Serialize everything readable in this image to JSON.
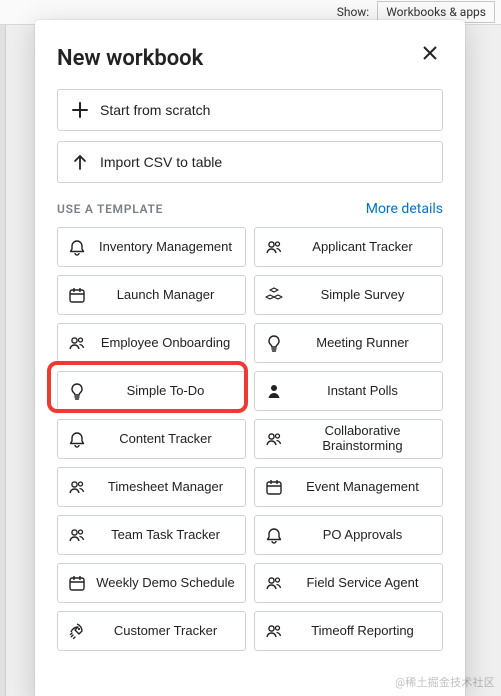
{
  "background": {
    "show_label": "Show:",
    "segment": "Workbooks & apps"
  },
  "modal": {
    "title": "New workbook",
    "close_aria": "Close",
    "scratch_label": "Start from scratch",
    "import_label": "Import CSV to table",
    "template_section_label": "USE A TEMPLATE",
    "more_details": "More details"
  },
  "templates": {
    "left": [
      {
        "icon": "bell",
        "label": "Inventory Management"
      },
      {
        "icon": "calendar",
        "label": "Launch Manager"
      },
      {
        "icon": "people",
        "label": "Employee Onboarding"
      },
      {
        "icon": "bulb",
        "label": "Simple To-Do",
        "highlight": true
      },
      {
        "icon": "bell",
        "label": "Content Tracker"
      },
      {
        "icon": "people",
        "label": "Timesheet Manager"
      },
      {
        "icon": "people",
        "label": "Team Task Tracker"
      },
      {
        "icon": "calendar",
        "label": "Weekly Demo Schedule"
      },
      {
        "icon": "rocket",
        "label": "Customer Tracker"
      }
    ],
    "right": [
      {
        "icon": "people",
        "label": "Applicant Tracker"
      },
      {
        "icon": "cubes",
        "label": "Simple Survey"
      },
      {
        "icon": "bulb",
        "label": "Meeting Runner"
      },
      {
        "icon": "person",
        "label": "Instant Polls"
      },
      {
        "icon": "people",
        "label": "Collaborative Brainstorming"
      },
      {
        "icon": "calendar",
        "label": "Event Management"
      },
      {
        "icon": "bell",
        "label": "PO Approvals"
      },
      {
        "icon": "people",
        "label": "Field Service Agent"
      },
      {
        "icon": "people",
        "label": "Timeoff Reporting"
      }
    ]
  },
  "watermark": "@稀土掘金技术社区",
  "colors": {
    "link": "#0073cf",
    "halo": "#ef3a2f",
    "border": "#d0d3d6"
  }
}
